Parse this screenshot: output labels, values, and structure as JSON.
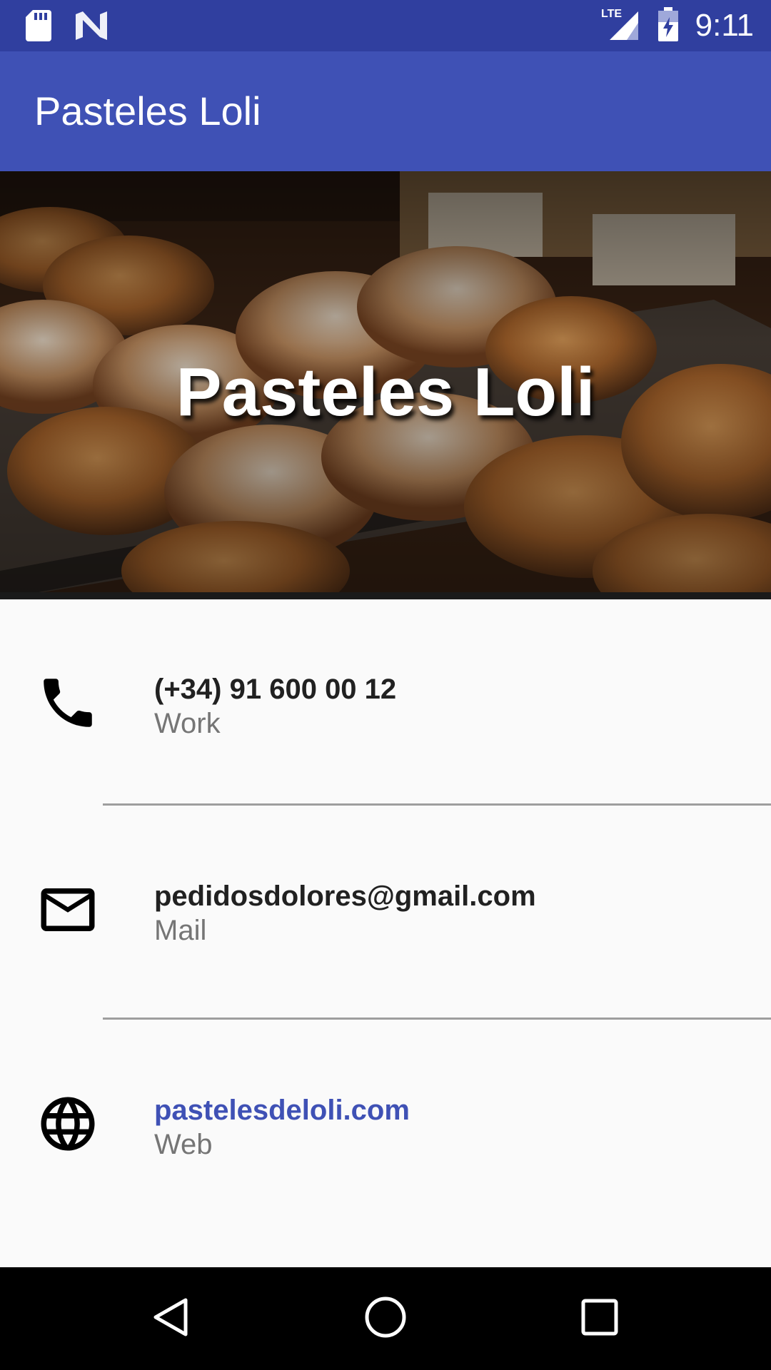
{
  "status_bar": {
    "time": "9:11",
    "network": "LTE",
    "icons": [
      "sd-card-icon",
      "n-logo-icon",
      "signal-icon",
      "battery-icon"
    ]
  },
  "app_bar": {
    "title": "Pasteles Loli",
    "color": "#3f51b5"
  },
  "hero": {
    "title": "Pasteles Loli"
  },
  "contacts": [
    {
      "icon": "phone-icon",
      "primary": "(+34) 91 600 00 12",
      "secondary": "Work"
    },
    {
      "icon": "mail-icon",
      "primary": "pedidosdolores@gmail.com",
      "secondary": "Mail"
    },
    {
      "icon": "globe-icon",
      "primary": "pastelesdeloli.com",
      "secondary": "Web"
    }
  ],
  "nav_bar": {
    "buttons": [
      "back-icon",
      "home-icon",
      "recents-icon"
    ]
  },
  "colors": {
    "status_bar": "#303f9f",
    "link": "#3f51b5"
  }
}
